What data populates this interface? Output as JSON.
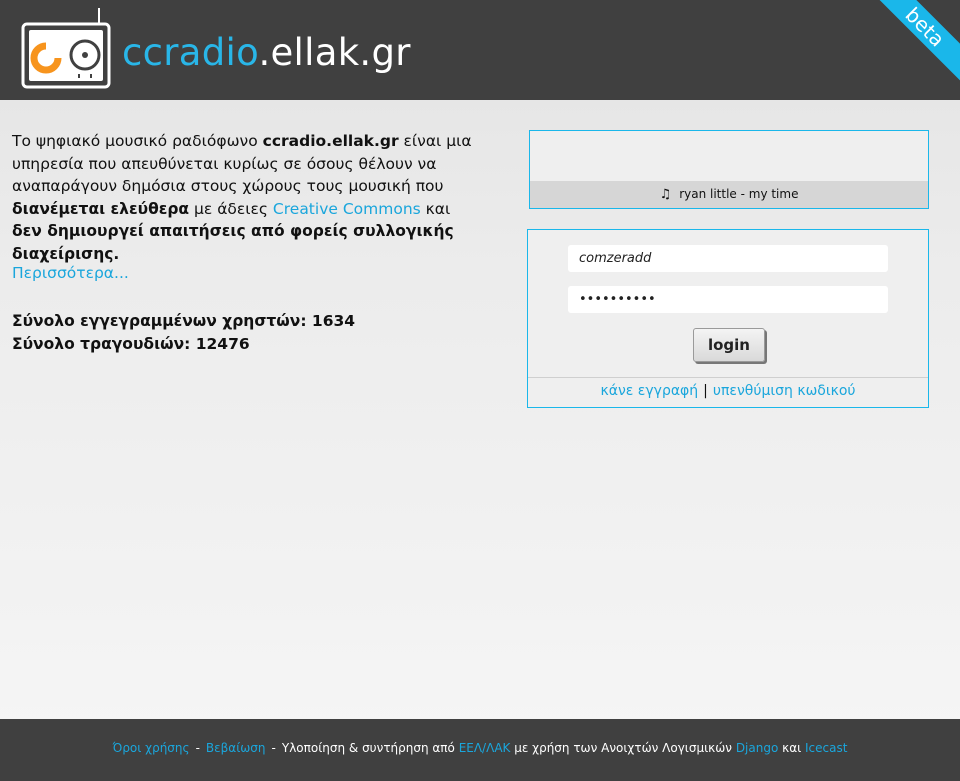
{
  "header": {
    "title_part1": "ccradio",
    "title_part2": ".ellak.gr",
    "beta_label": "beta"
  },
  "intro": {
    "t1": "Το ψηφιακό μουσικό ραδιόφωνο ",
    "b1": "ccradio.ellak.gr",
    "t2": " είναι μια υπηρεσία που απευθύνεται κυρίως σε όσους θέλουν να αναπαράγουν δημόσια στους χώρους τους μουσική που ",
    "b2": "διανέμεται ελεύθερα",
    "t3": " με άδειες ",
    "link_cc": "Creative Commons",
    "t4": " και ",
    "b3": "δεν δημιουργεί απαιτήσεις από φορείς συλλογικής διαχείρισης.",
    "more_link": "Περισσότερα..."
  },
  "stats": {
    "users": "Σύνολο εγγεγραμμένων χρηστών: 1634",
    "songs": "Σύνολο τραγουδιών: 12476"
  },
  "player": {
    "note_icon": "♫",
    "now_playing": "ryan little - my time"
  },
  "login": {
    "username_value": "comzeradd",
    "password_value": "••••••••••",
    "button_label": "login",
    "register_link": "κάνε εγγραφή",
    "pipe": "|",
    "reminder_link": "υπενθύμιση κωδικού"
  },
  "footer": {
    "terms_link": "Όροι χρήσης",
    "dash": "-",
    "cert_link": "Βεβαίωση",
    "text1": "Υλοποίηση & συντήρηση από ",
    "eellak_link": "ΕΕΛ/ΛΑΚ",
    "text2": " με χρήση των Ανοιχτών Λογισμικών ",
    "django_link": "Django",
    "text3": " και ",
    "icecast_link": "Icecast"
  },
  "colors": {
    "accent": "#1ab7ea",
    "header_bg": "#404040",
    "logo_orange": "#f7941d"
  }
}
